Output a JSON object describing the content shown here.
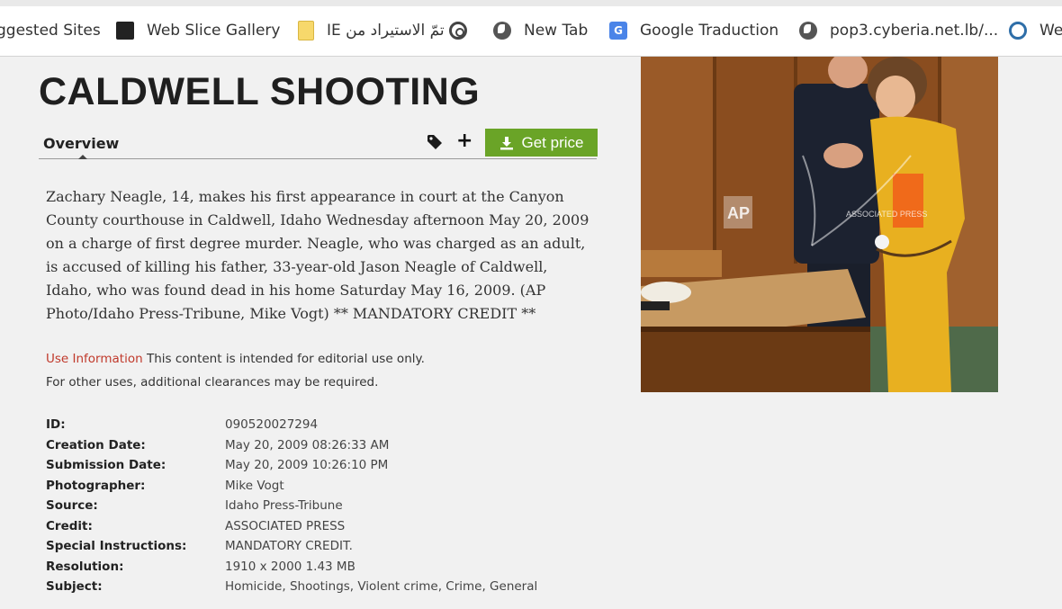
{
  "bookmarks": [
    {
      "label": "ggested Sites",
      "icon": "none"
    },
    {
      "label": "Web Slice Gallery",
      "icon": "web-slice-icon"
    },
    {
      "label": "IE تمّ الاستيراد من",
      "icon": "folder-icon"
    },
    {
      "label": "",
      "icon": "target-icon"
    },
    {
      "label": "New Tab",
      "icon": "globe-icon"
    },
    {
      "label": "Google Traduction",
      "icon": "google-translate-icon"
    },
    {
      "label": "pop3.cyberia.net.lb/...",
      "icon": "globe-icon"
    },
    {
      "label": "We",
      "icon": "wave-icon"
    }
  ],
  "page": {
    "title": "CALDWELL SHOOTING",
    "tab_overview": "Overview",
    "get_price": "Get price",
    "description": "Zachary Neagle, 14, makes his first appearance in court at the Canyon County courthouse in Caldwell, Idaho Wednesday afternoon May 20, 2009 on a charge of first degree murder. Neagle, who was charged as an adult, is accused of killing his father, 33-year-old Jason Neagle of Caldwell, Idaho, who was found dead in his home Saturday May 16, 2009. (AP Photo/Idaho Press-Tribune, Mike Vogt) ** MANDATORY CREDIT **",
    "use_info_link": "Use Information",
    "use_info_text": "This content is intended for editorial use only.",
    "use_info_text2": "For other uses, additional clearances may be required."
  },
  "metadata": [
    {
      "key": "ID:",
      "value": "090520027294"
    },
    {
      "key": "Creation Date:",
      "value": "May 20, 2009 08:26:33 AM"
    },
    {
      "key": "Submission Date:",
      "value": "May 20, 2009 10:26:10 PM"
    },
    {
      "key": "Photographer:",
      "value": "Mike Vogt"
    },
    {
      "key": "Source:",
      "value": "Idaho Press-Tribune"
    },
    {
      "key": "Credit:",
      "value": "ASSOCIATED PRESS"
    },
    {
      "key": "Special Instructions:",
      "value": "MANDATORY CREDIT."
    },
    {
      "key": "Resolution:",
      "value": "1910 x 2000 1.43 MB"
    },
    {
      "key": "Subject:",
      "value": "Homicide, Shootings, Violent crime, Crime, General"
    }
  ],
  "photo": {
    "watermark": "AP",
    "watermark_text": "ASSOCIATED PRESS"
  },
  "colors": {
    "accent_green": "#6aa427",
    "link_red": "#c0392b"
  }
}
